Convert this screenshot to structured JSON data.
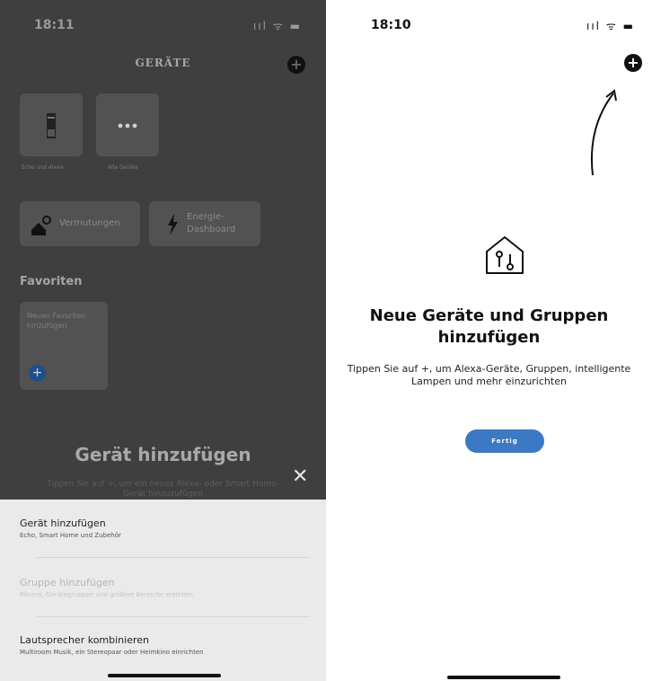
{
  "left_screen": {
    "status": {
      "time": "18:11",
      "icons": "ııl ᯤ ▬"
    },
    "header": {
      "title": "GERÄTE",
      "add_icon": "plus-circle-icon"
    },
    "tiles": [
      {
        "label": "Echo und Alexa",
        "icon": "echo-device-icon"
      },
      {
        "label": "Alle Geräte",
        "icon": "more-dots-icon"
      }
    ],
    "wide_tiles": [
      {
        "label": "Vermutungen",
        "icon": "home-lightbulb-icon"
      },
      {
        "label_line1": "Energie-",
        "label_line2": "Dashboard",
        "icon": "lightning-icon"
      }
    ],
    "favorites": {
      "title": "Favoriten",
      "tile_text": "Neuen Favoriten hinzufügen",
      "add_icon": "plus-circle-icon"
    },
    "overlay": {
      "title": "Gerät hinzufügen",
      "subtitle": "Tippen Sie auf +, um ein neues Alexa- oder Smart Home-Gerät hinzuzufügen"
    },
    "sheet": {
      "items": [
        {
          "title": "Gerät hinzufügen",
          "desc": "Echo, Smart Home und Zubehör",
          "enabled": true
        },
        {
          "title": "Gruppe hinzufügen",
          "desc": "Räume, Gerätegruppen und größere Bereiche erstellen",
          "enabled": false
        },
        {
          "title": "Lautsprecher kombinieren",
          "desc": "Multiroom Musik, ein Stereopaar oder Heimkino einrichten",
          "enabled": true
        }
      ]
    }
  },
  "right_screen": {
    "status": {
      "time": "18:10",
      "icons": "ııl ᯤ ▬"
    },
    "add_icon": "plus-circle-icon",
    "empty_state": {
      "icon": "home-devices-icon",
      "title": "Neue Geräte und Gruppen hinzufügen",
      "description": "Tippen Sie auf +, um Alexa-Geräte, Gruppen, intelligente Lampen und mehr einzurichten",
      "button": "Fertig"
    }
  },
  "colors": {
    "accent": "#3b79c4",
    "overlay": "#3f3f3f",
    "sheet": "#eaeaea"
  }
}
